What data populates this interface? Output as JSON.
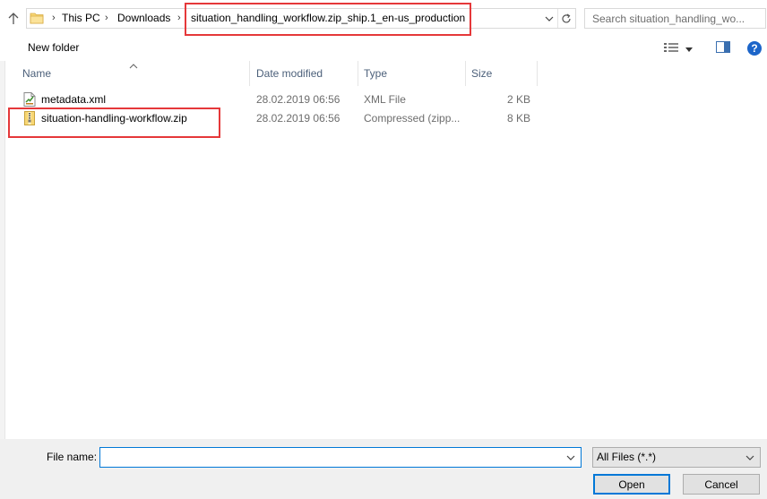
{
  "address_bar": {
    "breadcrumbs": [
      {
        "label": "This PC"
      },
      {
        "label": "Downloads"
      },
      {
        "label": "situation_handling_workflow.zip_ship.1_en-us_production"
      }
    ]
  },
  "search": {
    "placeholder": "Search situation_handling_wo..."
  },
  "toolbar": {
    "new_folder_label": "New folder"
  },
  "columns": {
    "name": "Name",
    "date_modified": "Date modified",
    "type": "Type",
    "size": "Size"
  },
  "files": [
    {
      "name": "metadata.xml",
      "date_modified": "28.02.2019 06:56",
      "type": "XML File",
      "size": "2 KB",
      "icon": "xml-file-icon"
    },
    {
      "name": "situation-handling-workflow.zip",
      "date_modified": "28.02.2019 06:56",
      "type": "Compressed (zipp...",
      "size": "8 KB",
      "icon": "zip-folder-icon"
    }
  ],
  "footer": {
    "file_name_label": "File name:",
    "file_name_value": "",
    "file_type_selected": "All Files (*.*)",
    "open_label": "Open",
    "cancel_label": "Cancel"
  },
  "colors": {
    "highlight": "#e5383a",
    "focus_border": "#0078d7",
    "header_text": "#4c607a"
  }
}
